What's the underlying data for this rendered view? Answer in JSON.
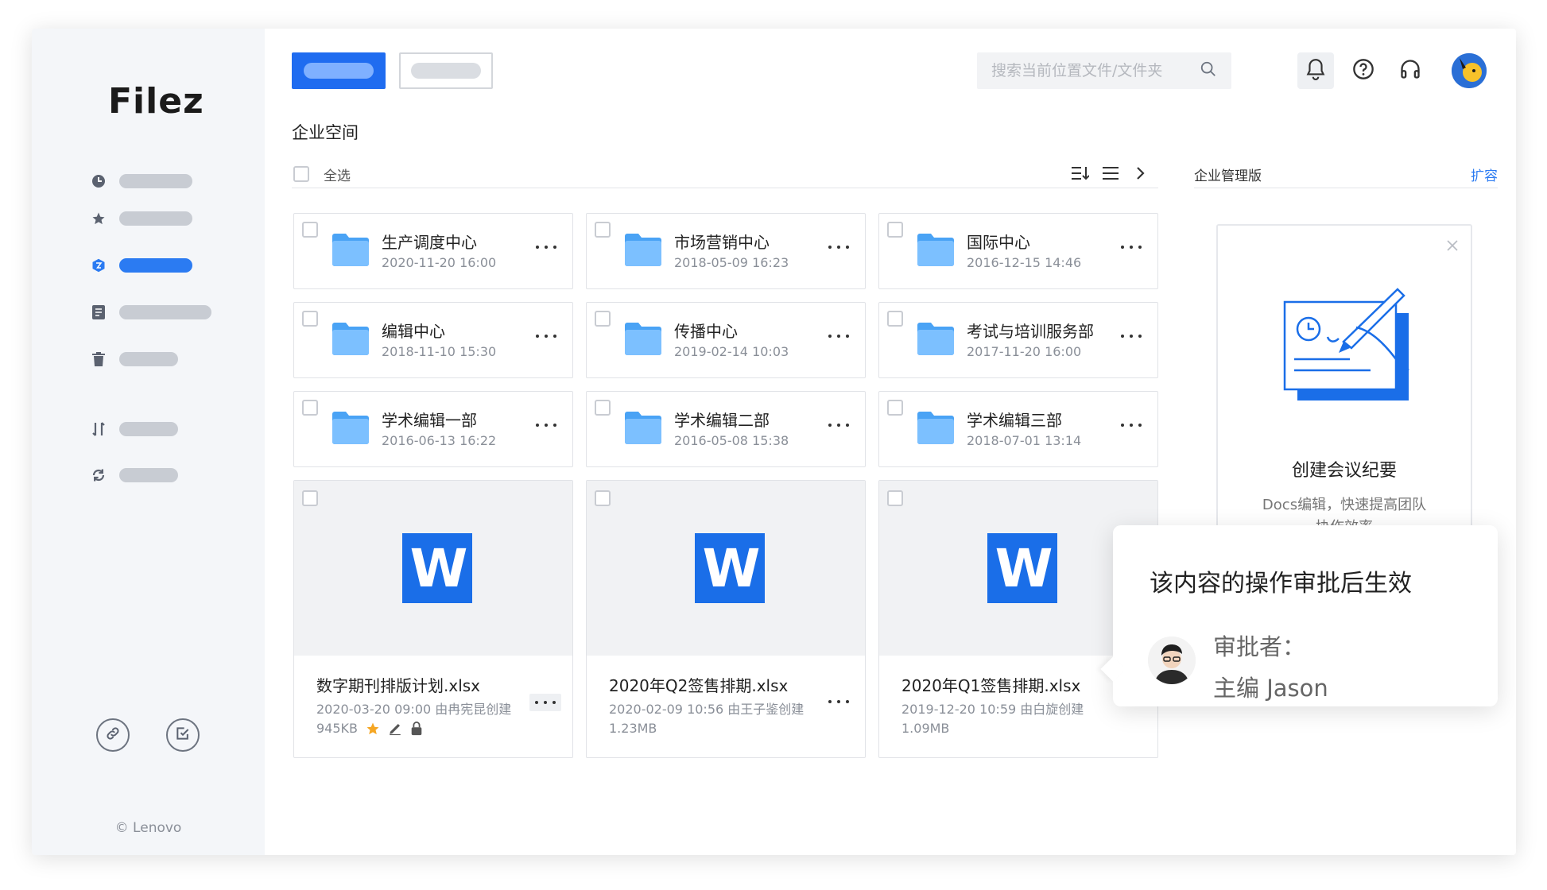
{
  "app": {
    "logo": "Filez",
    "copyright": "© Lenovo"
  },
  "page": {
    "title": "企业空间"
  },
  "search": {
    "placeholder": "搜索当前位置文件/文件夹"
  },
  "toolbar": {
    "select_all": "全选"
  },
  "folders": [
    {
      "name": "生产调度中心",
      "date": "2020-11-20 16:00"
    },
    {
      "name": "市场营销中心",
      "date": "2018-05-09 16:23"
    },
    {
      "name": "国际中心",
      "date": "2016-12-15 14:46"
    },
    {
      "name": "编辑中心",
      "date": "2018-11-10 15:30"
    },
    {
      "name": "传播中心",
      "date": "2019-02-14 10:03"
    },
    {
      "name": "考试与培训服务部",
      "date": "2017-11-20 16:00"
    },
    {
      "name": "学术编辑一部",
      "date": "2016-06-13 16:22"
    },
    {
      "name": "学术编辑二部",
      "date": "2016-05-08 15:38"
    },
    {
      "name": "学术编辑三部",
      "date": "2018-07-01 13:14"
    }
  ],
  "files": [
    {
      "name": "数字期刊排版计划.xlsx",
      "meta": "2020-03-20 09:00 由冉宪昆创建",
      "size": "945KB",
      "icon_letter": "W"
    },
    {
      "name": "2020年Q2签售排期.xlsx",
      "meta": "2020-02-09 10:56 由王子鉴创建",
      "size": "1.23MB",
      "icon_letter": "W"
    },
    {
      "name": "2020年Q1签售排期.xlsx",
      "meta": "2019-12-20 10:59 由白旋创建",
      "size": "1.09MB",
      "icon_letter": "W"
    }
  ],
  "panel": {
    "title": "企业管理版",
    "link": "扩容",
    "promo_title": "创建会议纪要",
    "promo_desc": "Docs编辑，快速提高团队",
    "promo_desc2": "协作效率"
  },
  "popup": {
    "title": "该内容的操作审批后生效",
    "label": "审批者：",
    "name": "主编 Jason"
  },
  "colors": {
    "primary": "#1f6cf0",
    "folder": "#6fb7ff",
    "word": "#1a6ee8",
    "accent_link": "#2b7bf2"
  }
}
